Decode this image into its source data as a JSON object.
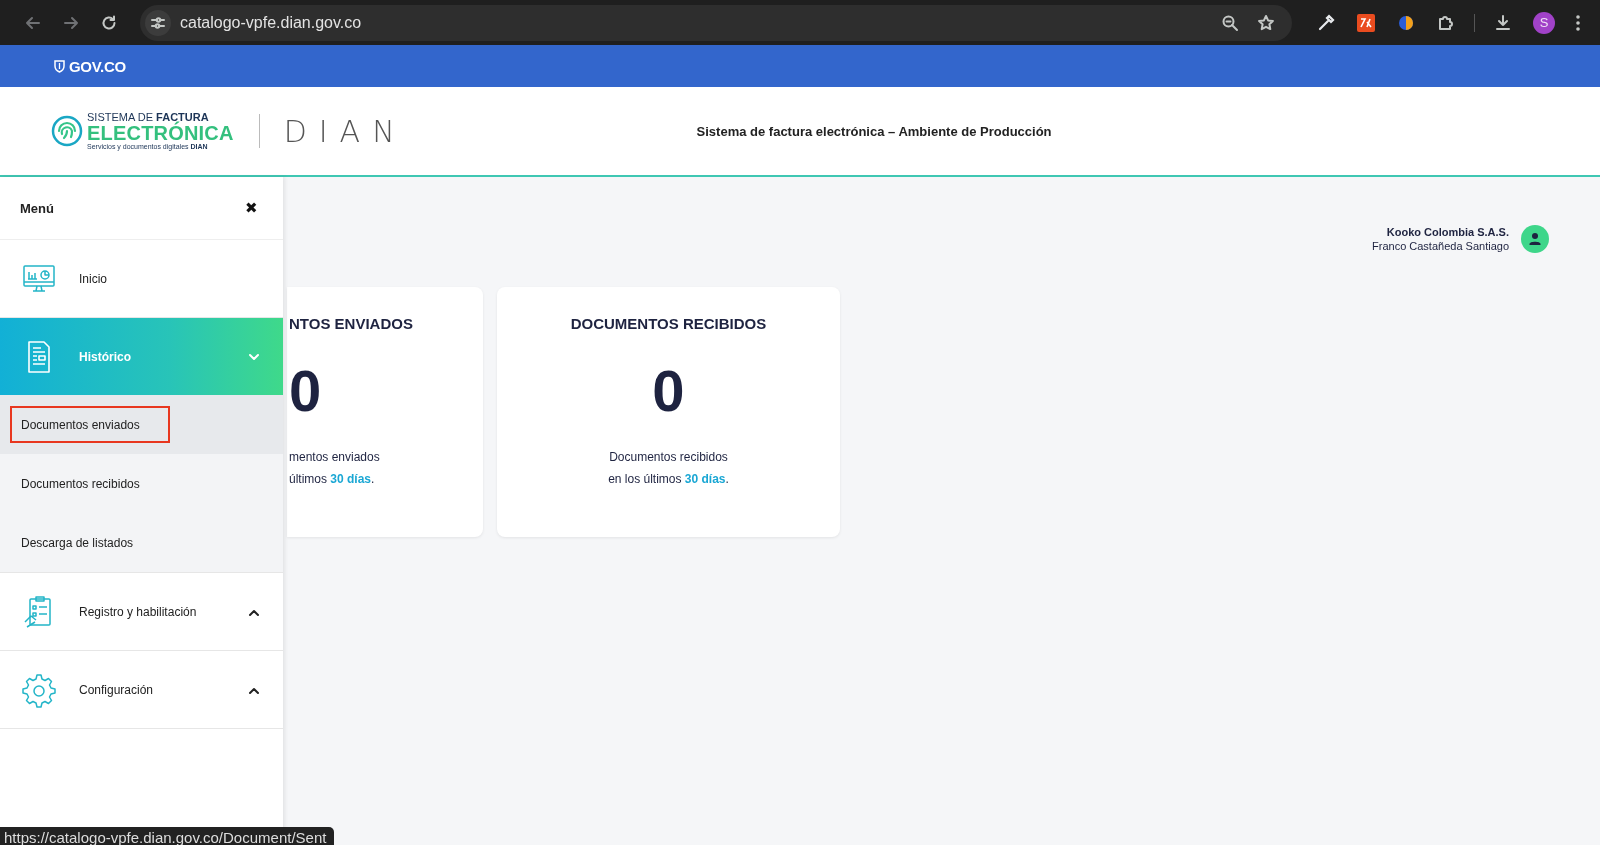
{
  "browser": {
    "url": "catalogo-vpfe.dian.gov.co",
    "profile_initial": "S",
    "status_url": "https://catalogo-vpfe.dian.gov.co/Document/Sent"
  },
  "gov_bar": {
    "label": "GOV.CO"
  },
  "header": {
    "logo_line_1": "SISTEMA DE **FACTURA**",
    "logo_line_2": "ELECTRÓNICA",
    "logo_line_3": "Servicios y documentos digitales **DIAN**",
    "brand": "DIAN",
    "title": "Sistema de factura electrónica – Ambiente de Producción"
  },
  "user": {
    "company": "Kooko Colombia S.A.S.",
    "name": "Franco Castañeda Santiago"
  },
  "cards": [
    {
      "partial": true,
      "title": "NTOS ENVIADOS",
      "count": "0",
      "caption_1": "mentos enviados",
      "caption_2": "últimos **30 días**."
    },
    {
      "partial": false,
      "title": "DOCUMENTOS RECIBIDOS",
      "count": "0",
      "caption_1": "Documentos recibidos",
      "caption_2": "en los últimos **30 días**."
    }
  ],
  "menu": {
    "title": "Menú",
    "close": "✖",
    "items": [
      {
        "label": "Inicio",
        "selected": false
      },
      {
        "label": "Histórico",
        "selected": true,
        "expanded": true,
        "children": [
          {
            "label": "Documentos enviados",
            "selected": true,
            "highlighted": true
          },
          {
            "label": "Documentos recibidos",
            "selected": false,
            "highlighted": false
          },
          {
            "label": "Descarga de listados",
            "selected": false,
            "highlighted": false
          }
        ]
      },
      {
        "label": "Registro y habilitación",
        "selected": false,
        "expanded": false
      },
      {
        "label": "Configuración",
        "selected": false,
        "expanded": false
      }
    ]
  }
}
